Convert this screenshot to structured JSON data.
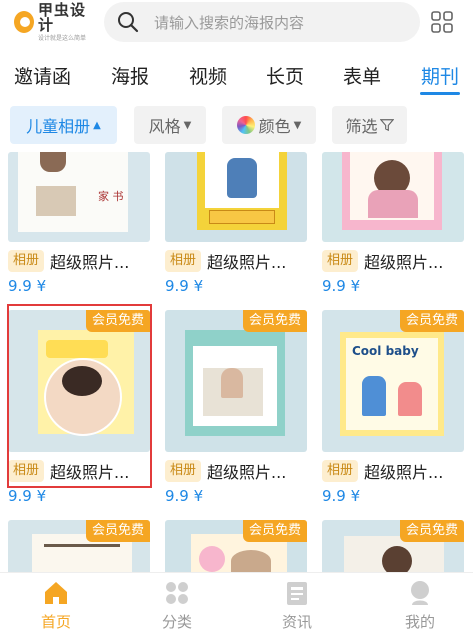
{
  "header": {
    "logo_title": "甲虫设计",
    "logo_subtitle": "设计就是这么简单",
    "search_placeholder": "请输入搜索的海报内容"
  },
  "tabs": [
    {
      "label": "邀请函",
      "active": false
    },
    {
      "label": "海报",
      "active": false
    },
    {
      "label": "视频",
      "active": false
    },
    {
      "label": "长页",
      "active": false
    },
    {
      "label": "表单",
      "active": false
    },
    {
      "label": "期刊",
      "active": true
    }
  ],
  "filters": {
    "category": "儿童相册",
    "style": "风格",
    "color": "颜色",
    "screen": "筛选"
  },
  "cards": [
    {
      "tag": "相册",
      "title": "超级照片...",
      "price": "9.9 ¥",
      "badge": "",
      "art_text": "家 书"
    },
    {
      "tag": "相册",
      "title": "超级照片...",
      "price": "9.9 ¥",
      "badge": "",
      "art_text": ""
    },
    {
      "tag": "相册",
      "title": "超级照片...",
      "price": "9.9 ¥",
      "badge": "",
      "art_text": ""
    },
    {
      "tag": "相册",
      "title": "超级照片...",
      "price": "9.9 ¥",
      "badge": "会员免费",
      "art_text": ""
    },
    {
      "tag": "相册",
      "title": "超级照片...",
      "price": "9.9 ¥",
      "badge": "会员免费",
      "art_text": ""
    },
    {
      "tag": "相册",
      "title": "超级照片...",
      "price": "9.9 ¥",
      "badge": "会员免费",
      "art_text": "Cool baby"
    },
    {
      "tag": "",
      "title": "",
      "price": "",
      "badge": "会员免费",
      "art_text": ""
    },
    {
      "tag": "",
      "title": "",
      "price": "",
      "badge": "会员免费",
      "art_text": ""
    },
    {
      "tag": "",
      "title": "",
      "price": "",
      "badge": "会员免费",
      "art_text": ""
    }
  ],
  "bottom_nav": [
    {
      "label": "首页",
      "icon": "home-icon",
      "active": true
    },
    {
      "label": "分类",
      "icon": "category-icon",
      "active": false
    },
    {
      "label": "资讯",
      "icon": "news-icon",
      "active": false
    },
    {
      "label": "我的",
      "icon": "profile-icon",
      "active": false
    }
  ],
  "colors": {
    "accent_blue": "#1e88e5",
    "badge_orange": "#f5a623",
    "tag_bg": "#fdeecf",
    "selection_red": "#e23b3b"
  }
}
